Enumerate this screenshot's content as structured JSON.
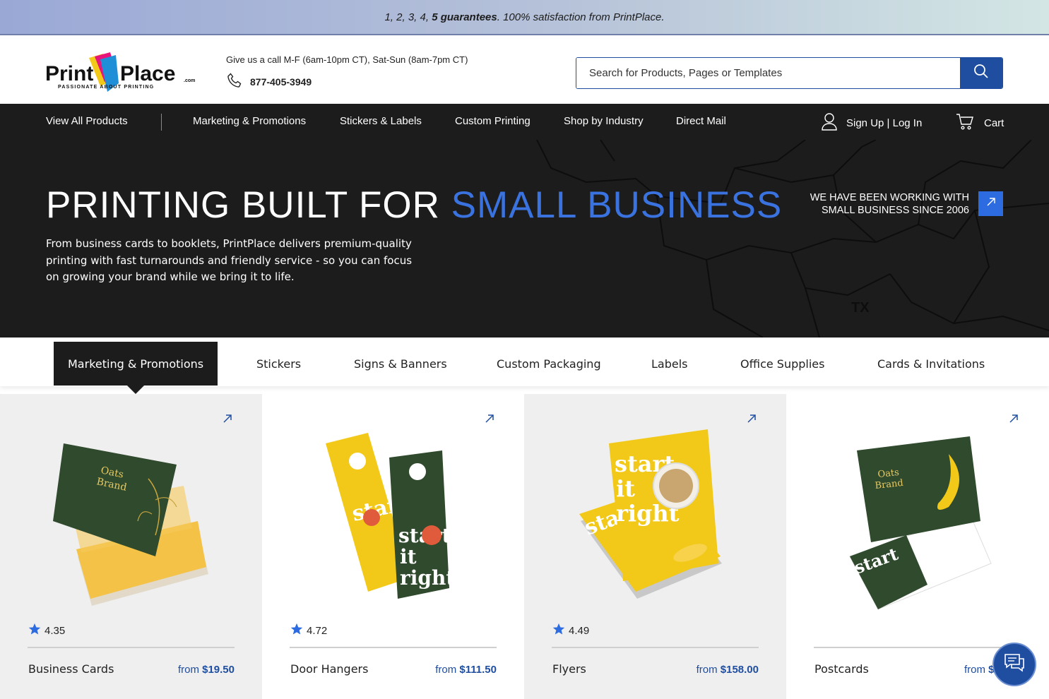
{
  "promo": {
    "pre": "1, 2, 3, 4,",
    "bold": "5 guarantees",
    "post": ". 100% satisfaction from PrintPlace."
  },
  "header": {
    "logo_text": "PrintPlace",
    "logo_tagline": "PASSIONATE ABOUT PRINTING",
    "call_hours": "Give us a call M-F (6am-10pm CT), Sat-Sun (8am-7pm CT)",
    "phone": "877-405-3949",
    "search_placeholder": "Search for Products, Pages or Templates"
  },
  "nav": {
    "items": [
      "View All Products",
      "Marketing & Promotions",
      "Stickers & Labels",
      "Custom Printing",
      "Shop by Industry",
      "Direct Mail"
    ],
    "account": "Sign Up | Log In",
    "cart": "Cart"
  },
  "hero": {
    "title_plain": "PRINTING BUILT FOR ",
    "title_accent": "SMALL BUSINESS",
    "description": "From business cards to booklets, PrintPlace delivers premium-quality printing with fast turnarounds and friendly service - so you can focus on growing your brand while we bring it to life.",
    "since_line1": "WE HAVE BEEN WORKING WITH",
    "since_line2": "SMALL BUSINESS SINCE 2006",
    "map_label": "TX"
  },
  "tabs": [
    "Marketing & Promotions",
    "Stickers",
    "Signs & Banners",
    "Custom Packaging",
    "Labels",
    "Office Supplies",
    "Cards & Invitations"
  ],
  "products": [
    {
      "name": "Business Cards",
      "rating": "4.35",
      "from": "from",
      "price": "$19.50"
    },
    {
      "name": "Door Hangers",
      "rating": "4.72",
      "from": "from",
      "price": "$111.50"
    },
    {
      "name": "Flyers",
      "rating": "4.49",
      "from": "from",
      "price": "$158.00"
    },
    {
      "name": "Postcards",
      "rating": "",
      "from": "from",
      "price": "$14.00"
    }
  ],
  "colors": {
    "accent_blue": "#3a73df",
    "brand_blue": "#1f4ea1",
    "dark": "#1c1c1c",
    "product_green": "#2f4a2c",
    "product_yellow": "#f2c919"
  }
}
